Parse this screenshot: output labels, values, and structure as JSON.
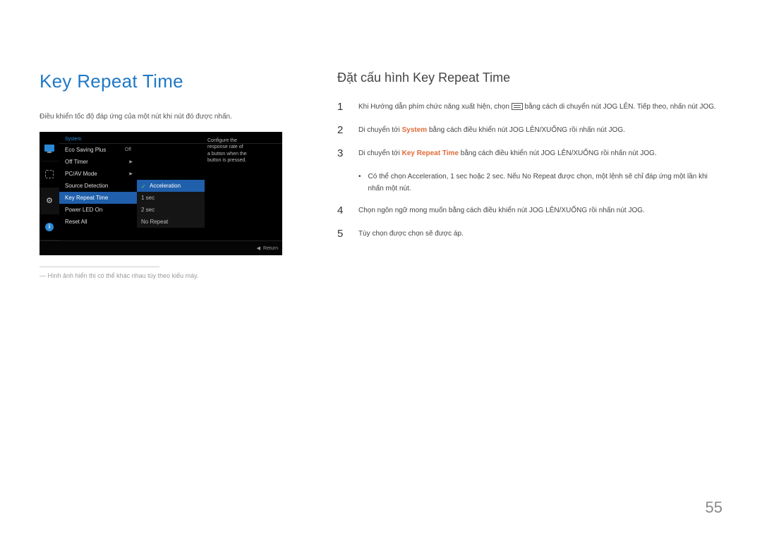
{
  "left": {
    "title": "Key Repeat Time",
    "desc": "Điều khiển tốc độ đáp ứng của một nút khi nút đó được nhấn.",
    "note_divider": "―",
    "note": "Hình ảnh hiển thị có thể khác nhau tùy theo kiểu máy."
  },
  "osd": {
    "header": "System",
    "rows": [
      {
        "label": "Eco Saving Plus",
        "val": "Off"
      },
      {
        "label": "Off Timer",
        "arrow": "▶"
      },
      {
        "label": "PC/AV Mode",
        "arrow": "▶"
      },
      {
        "label": "Source Detection"
      },
      {
        "label": "Key Repeat Time",
        "sel": true
      },
      {
        "label": "Power LED On"
      },
      {
        "label": "Reset All"
      }
    ],
    "options": [
      {
        "label": "Acceleration",
        "sel": true,
        "check": true
      },
      {
        "label": "1 sec"
      },
      {
        "label": "2 sec"
      },
      {
        "label": "No Repeat"
      }
    ],
    "info_lines": [
      "Configure the",
      "response rate of",
      "a button when the",
      "button is pressed."
    ],
    "return_arrow": "◀",
    "return_label": "Return"
  },
  "right": {
    "title": "Đặt cấu hình Key Repeat Time",
    "steps": [
      {
        "num": "1",
        "parts": [
          {
            "t": "Khi Hướng dẫn phím chức năng xuất hiện, chọn "
          },
          {
            "icon": "menu"
          },
          {
            "t": " bằng cách di chuyển nút JOG LÊN. Tiếp theo, nhấn nút JOG."
          }
        ]
      },
      {
        "num": "2",
        "parts": [
          {
            "t": "Di chuyển tới "
          },
          {
            "t": "System",
            "cls": "hl-red bold"
          },
          {
            "t": " bằng cách điều khiển nút JOG LÊN/XUỐNG rồi nhấn nút JOG."
          }
        ]
      },
      {
        "num": "3",
        "parts": [
          {
            "t": "Di chuyển tới "
          },
          {
            "t": "Key Repeat Time",
            "cls": "hl-red bold"
          },
          {
            "t": " bằng cách điều khiển nút JOG LÊN/XUỐNG rồi nhấn nút JOG."
          }
        ]
      },
      {
        "bullet": true,
        "parts": [
          {
            "t": "Có thể chọn "
          },
          {
            "t": "Acceleration",
            "cls": "hl-red bold"
          },
          {
            "t": ", "
          },
          {
            "t": "1 sec",
            "cls": "hl-red bold"
          },
          {
            "t": " hoặc "
          },
          {
            "t": "2 sec",
            "cls": "hl-red bold"
          },
          {
            "t": ". Nếu "
          },
          {
            "t": "No Repeat",
            "cls": "hl-red bold"
          },
          {
            "t": " được chọn, một lệnh sẽ chỉ đáp ứng một lần khi nhấn một nút."
          }
        ]
      },
      {
        "num": "4",
        "parts": [
          {
            "t": "Chọn ngôn ngữ mong muốn bằng cách điều khiển nút JOG LÊN/XUỐNG rồi nhấn nút JOG."
          }
        ]
      },
      {
        "num": "5",
        "parts": [
          {
            "t": "Tùy chọn được chọn sẽ được áp."
          }
        ]
      }
    ]
  },
  "page_number": "55"
}
